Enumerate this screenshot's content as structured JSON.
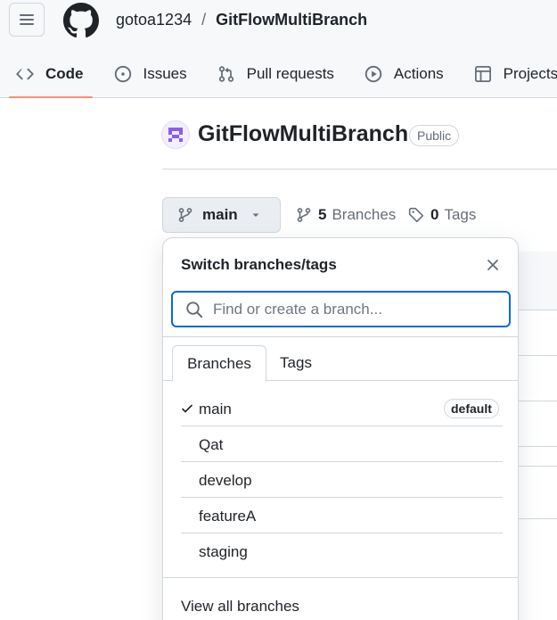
{
  "header": {
    "owner": "gotoa1234",
    "separator": "/",
    "repo": "GitFlowMultiBranch"
  },
  "tabs": [
    {
      "label": "Code",
      "icon": "code-icon",
      "active": true
    },
    {
      "label": "Issues",
      "icon": "issue-opened-icon"
    },
    {
      "label": "Pull requests",
      "icon": "git-pull-request-icon"
    },
    {
      "label": "Actions",
      "icon": "play-icon"
    },
    {
      "label": "Projects",
      "icon": "table-icon"
    }
  ],
  "repo_header": {
    "title": "GitFlowMultiBranch",
    "visibility": "Public"
  },
  "branch_selector": {
    "current": "main",
    "branches_count": "5",
    "branches_label": "Branches",
    "tags_count": "0",
    "tags_label": "Tags"
  },
  "popover": {
    "title": "Switch branches/tags",
    "search_placeholder": "Find or create a branch...",
    "tabs": [
      {
        "label": "Branches",
        "active": true
      },
      {
        "label": "Tags"
      }
    ],
    "branches": [
      {
        "name": "main",
        "selected": true,
        "badge": "default"
      },
      {
        "name": "Qat"
      },
      {
        "name": "develop"
      },
      {
        "name": "featureA"
      },
      {
        "name": "staging"
      }
    ],
    "view_all": "View all branches"
  },
  "colors": {
    "accent": "#0969da",
    "active_tab_underline": "#fd8c73",
    "border": "#d0d7de",
    "muted_text": "#656d76"
  }
}
